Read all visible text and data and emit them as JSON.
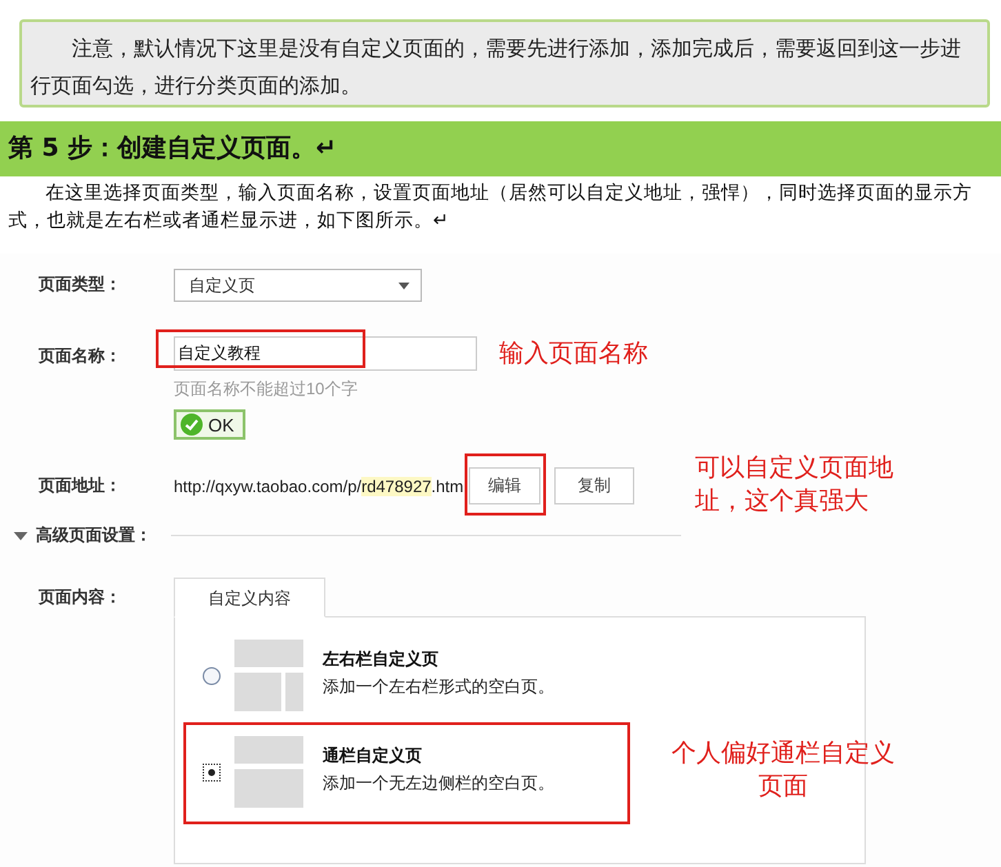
{
  "note": "注意，默认情况下这里是没有自定义页面的，需要先进行添加，添加完成后，需要返回到这一步进行页面勾选，进行分类页面的添加。",
  "heading": "第 5 步：创建自定义页面。↵",
  "intro": "在这里选择页面类型，输入页面名称，设置页面地址（居然可以自定义地址，强悍），同时选择页面的显示方式，也就是左右栏或者通栏显示进，如下图所示。↵",
  "form": {
    "page_type": {
      "label": "页面类型：",
      "value": "自定义页"
    },
    "page_name": {
      "label": "页面名称：",
      "value": "自定义教程",
      "hint": "页面名称不能超过10个字",
      "ok": "OK"
    },
    "page_url": {
      "label": "页面地址：",
      "prefix": "http://qxyw.taobao.com/p/",
      "slug": "rd478927",
      "suffix": ".htm",
      "buttons": [
        "编辑",
        "复制"
      ]
    },
    "advanced": {
      "label": "高级页面设置：",
      "expanded": true
    },
    "content": {
      "label": "页面内容：",
      "tabs": [
        {
          "label": "自定义内容",
          "selected": true
        }
      ],
      "options": [
        {
          "title": "左右栏自定义页",
          "desc": "添加一个左右栏形式的空白页。",
          "kind": "two-column",
          "selected": false
        },
        {
          "title": "通栏自定义页",
          "desc": "添加一个无左边侧栏的空白页。",
          "kind": "full-width",
          "selected": true
        }
      ]
    }
  },
  "annotations": [
    "输入页面名称",
    "可以自定义页面地址，这个真强大",
    "个人偏好通栏自定义页面"
  ]
}
